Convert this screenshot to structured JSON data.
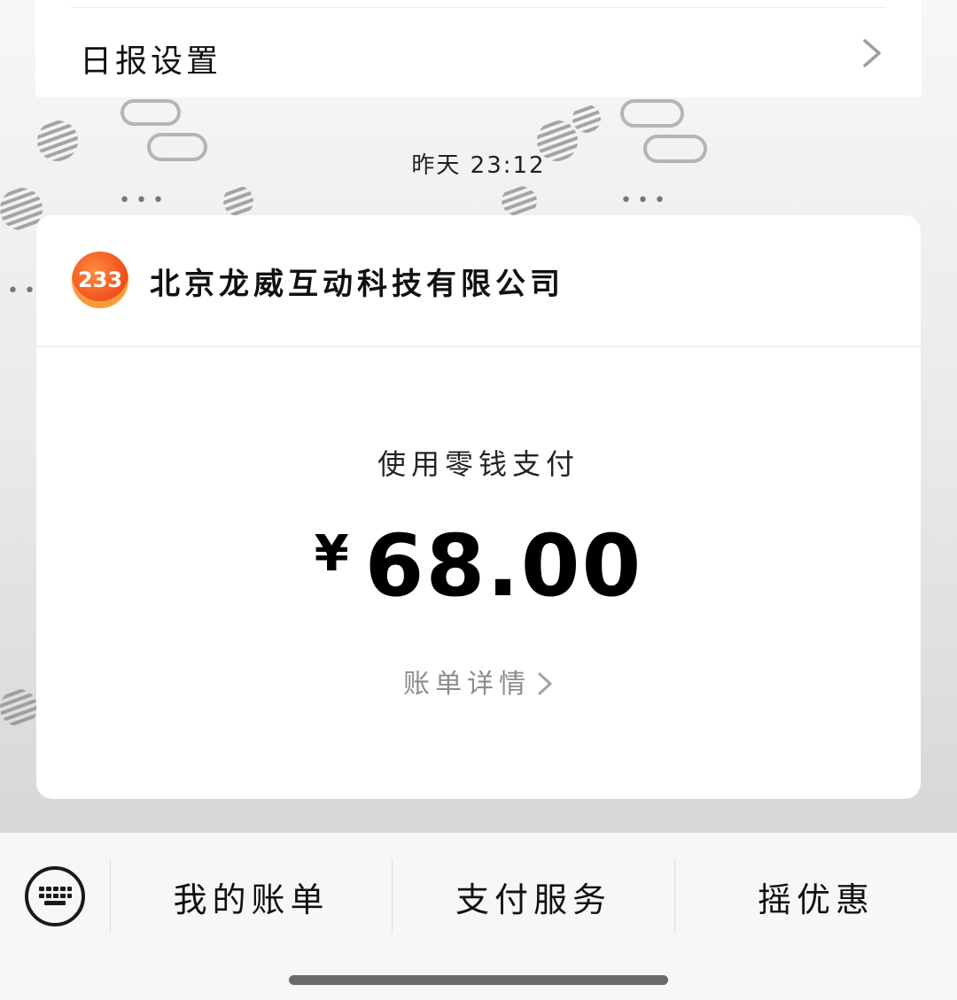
{
  "top_card": {
    "label": "日报设置"
  },
  "timestamp": "昨天 23:12",
  "merchant": {
    "avatar_text": "233",
    "name": "北京龙威互动科技有限公司"
  },
  "payment": {
    "method": "使用零钱支付",
    "currency": "¥",
    "amount": "68.00",
    "bill_link": "账单详情"
  },
  "bottom_menu": {
    "items": [
      {
        "label": "我的账单"
      },
      {
        "label": "支付服务"
      },
      {
        "label": "摇优惠"
      }
    ]
  },
  "colors": {
    "avatar_orange": "#f04e1b",
    "bill_link_gray": "#8c8c8c"
  }
}
